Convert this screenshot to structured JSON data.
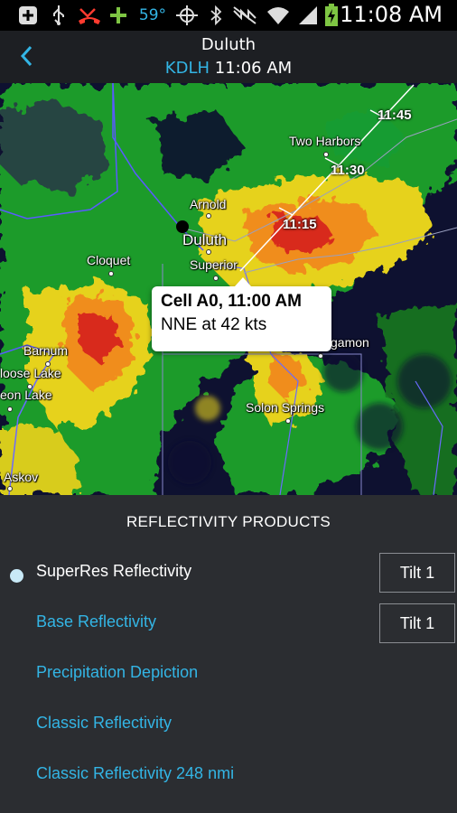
{
  "status_bar": {
    "temperature": "59°",
    "time": "11:08 AM",
    "icons": [
      "add-icon",
      "usb-icon",
      "missed-call-icon",
      "plus-icon",
      "gps-icon",
      "bluetooth-icon",
      "mute-icon",
      "wifi-icon",
      "signal-icon",
      "battery-charging-icon"
    ]
  },
  "header": {
    "title": "Duluth",
    "station": "KDLH",
    "time": "11:06 AM",
    "back_icon": "chevron-left-icon"
  },
  "map": {
    "places": [
      {
        "name": "Two Harbors"
      },
      {
        "name": "Arnold"
      },
      {
        "name": "Duluth"
      },
      {
        "name": "Superior"
      },
      {
        "name": "Cloquet"
      },
      {
        "name": "Barnum"
      },
      {
        "name": "loose Lake"
      },
      {
        "name": "eon Lake"
      },
      {
        "name": "Solon Springs"
      },
      {
        "name": "gamon"
      },
      {
        "name": "Askov"
      }
    ],
    "track_times": [
      "11:45",
      "11:30",
      "11:15"
    ],
    "callout": {
      "title": "Cell A0, 11:00 AM",
      "detail": "NNE at 42 kts"
    }
  },
  "products": {
    "title": "REFLECTIVITY PRODUCTS",
    "items": [
      {
        "label": "SuperRes Reflectivity",
        "selected": true,
        "tilt": "Tilt 1"
      },
      {
        "label": "Base Reflectivity",
        "selected": false,
        "tilt": "Tilt 1"
      },
      {
        "label": "Precipitation Depiction",
        "selected": false
      },
      {
        "label": "Classic Reflectivity",
        "selected": false
      },
      {
        "label": "Classic Reflectivity 248 nmi",
        "selected": false
      }
    ]
  },
  "colors": {
    "accent": "#33b5e5",
    "panel": "#2b2d31",
    "header": "#1d1f23"
  }
}
